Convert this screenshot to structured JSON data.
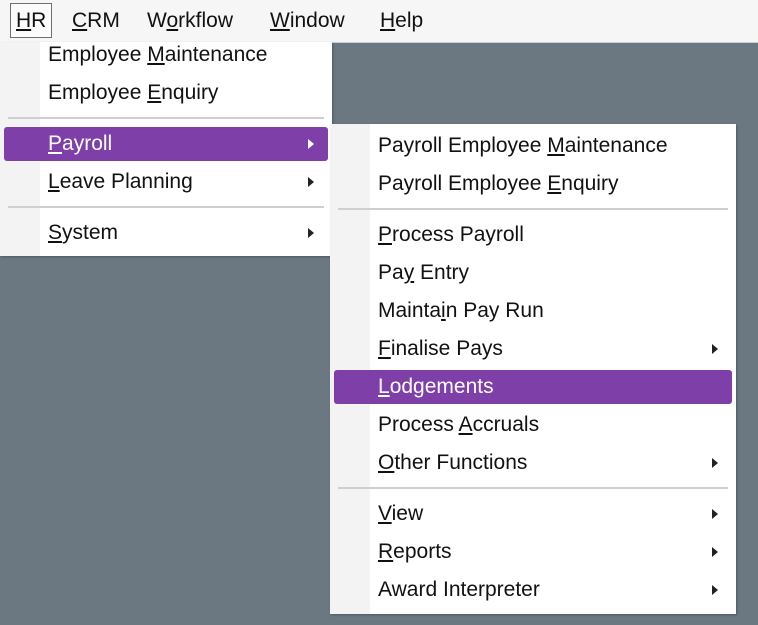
{
  "menubar": {
    "items": [
      {
        "id": "hr",
        "label": "HR",
        "underline": "H",
        "rest": "R",
        "active": true
      },
      {
        "id": "crm",
        "label": "CRM",
        "underline": "C",
        "rest": "RM",
        "active": false
      },
      {
        "id": "workflow",
        "label": "Workflow",
        "pre": "W",
        "underline": "o",
        "rest": "rkflow",
        "active": false
      },
      {
        "id": "window",
        "label": "Window",
        "underline": "W",
        "rest": "indow",
        "active": false
      },
      {
        "id": "help",
        "label": "Help",
        "underline": "H",
        "rest": "elp",
        "active": false
      }
    ]
  },
  "hr_menu": {
    "items": [
      {
        "pre": "Employee ",
        "u": "M",
        "post": "aintenance",
        "submenu": false
      },
      {
        "pre": "Employee ",
        "u": "E",
        "post": "nquiry",
        "submenu": false
      },
      {
        "pre": "",
        "u": "P",
        "post": "ayroll",
        "submenu": true,
        "highlighted": true
      },
      {
        "pre": "",
        "u": "L",
        "post": "eave Planning",
        "submenu": true
      },
      {
        "pre": "",
        "u": "S",
        "post": "ystem",
        "submenu": true
      }
    ]
  },
  "payroll_menu": {
    "items": [
      {
        "pre": "Payroll Employee ",
        "u": "M",
        "post": "aintenance",
        "submenu": false
      },
      {
        "pre": "Payroll Employee ",
        "u": "E",
        "post": "nquiry",
        "submenu": false
      },
      {
        "pre": "",
        "u": "P",
        "post": "rocess Payroll",
        "submenu": false
      },
      {
        "pre": "Pa",
        "u": "y",
        "post": " Entry",
        "submenu": false
      },
      {
        "pre": "Mainta",
        "u": "i",
        "post": "n Pay Run",
        "submenu": false
      },
      {
        "pre": "",
        "u": "F",
        "post": "inalise Pays",
        "submenu": true
      },
      {
        "pre": "",
        "u": "L",
        "post": "odgements",
        "submenu": false,
        "highlighted": true
      },
      {
        "pre": "Process ",
        "u": "A",
        "post": "ccruals",
        "submenu": false
      },
      {
        "pre": "",
        "u": "O",
        "post": "ther Functions",
        "submenu": true
      },
      {
        "pre": "",
        "u": "V",
        "post": "iew",
        "submenu": true
      },
      {
        "pre": "",
        "u": "R",
        "post": "eports",
        "submenu": true
      },
      {
        "pre": "Award Interpreter",
        "u": "",
        "post": "",
        "submenu": true
      }
    ]
  },
  "colors": {
    "highlight": "#7e3fa8",
    "desktop": "#6b7781",
    "menu_bg": "#ffffff",
    "menubar_bg": "#f6f6f6"
  }
}
